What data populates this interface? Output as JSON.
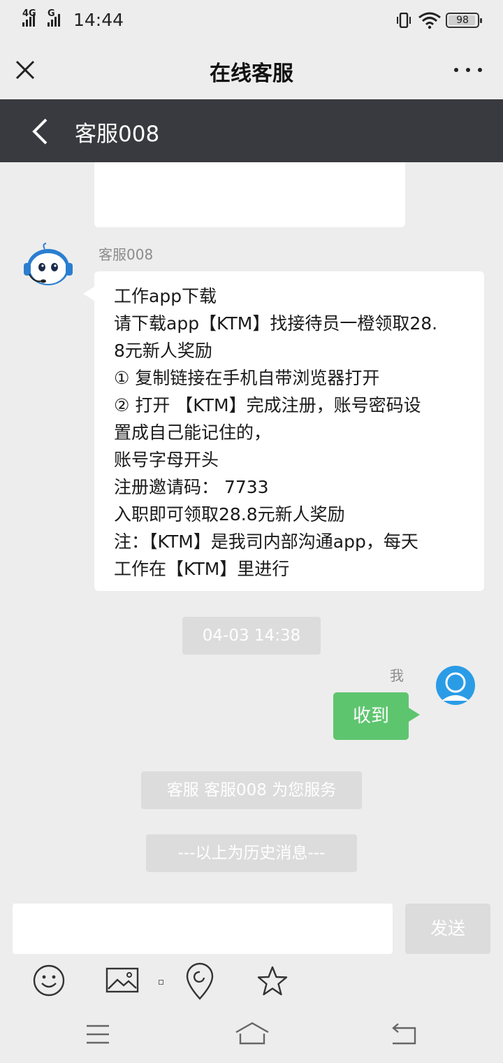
{
  "status_bar": {
    "network_1": "4G",
    "network_2": "G",
    "time": "14:44",
    "battery": "98"
  },
  "title_bar": {
    "title": "在线客服"
  },
  "chat_header": {
    "name": "客服008"
  },
  "agent_message": {
    "sender": "客服008",
    "lines": [
      "工作app下载",
      "请下载app【KTM】找接待员一橙领取28.",
      "8元新人奖励",
      "① 复制链接在手机自带浏览器打开",
      "② 打开 【KTM】完成注册，账号密码设",
      "置成自己能记住的，",
      "账号字母开头",
      "注册邀请码： 7733",
      "入职即可领取28.8元新人奖励",
      "注：【KTM】是我司内部沟通app，每天",
      "工作在【KTM】里进行"
    ]
  },
  "timestamp": "04-03 14:38",
  "my_message": {
    "sender": "我",
    "text": "收到"
  },
  "system_messages": {
    "service": "客服 客服008 为您服务",
    "history": "---以上为历史消息---"
  },
  "composer": {
    "input_value": "",
    "send_label": "发送"
  },
  "colors": {
    "header_dark": "#393a3f",
    "my_bubble": "#5ec56f",
    "avatar_blue": "#2a9ce6",
    "background": "#ededed"
  },
  "icons": {
    "toolbar": [
      "emoji-icon",
      "image-icon",
      "location-icon",
      "star-icon"
    ],
    "nav": [
      "menu-icon",
      "home-icon",
      "back-icon"
    ]
  }
}
